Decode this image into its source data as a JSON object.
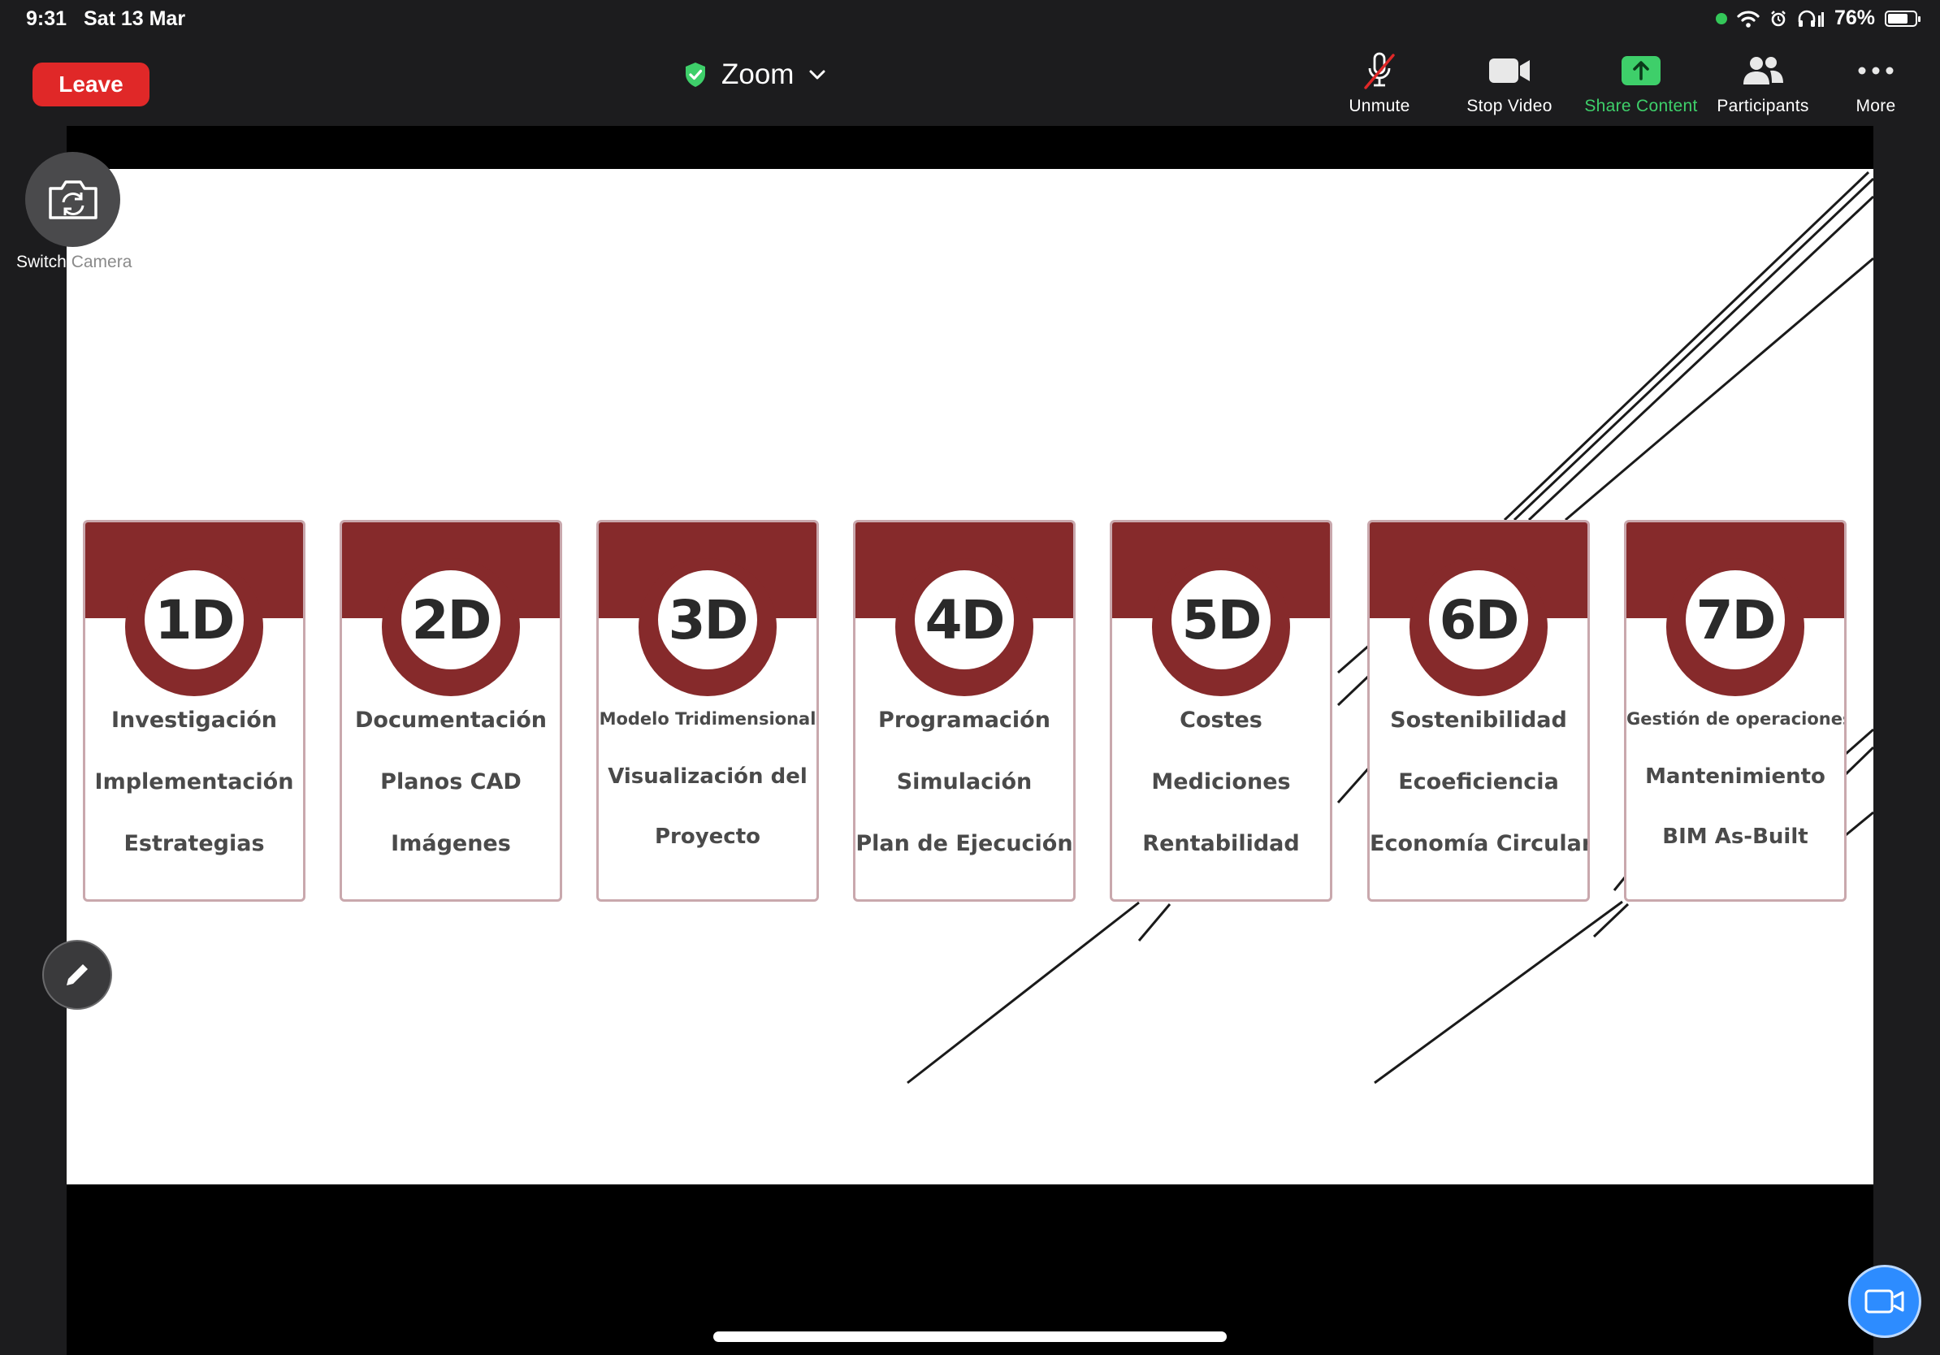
{
  "status_bar": {
    "time": "9:31",
    "date": "Sat 13 Mar",
    "battery_text": "76%",
    "battery_level": 0.76,
    "icons": [
      "green-dot",
      "wifi-icon",
      "alarm-icon",
      "headphones-icon",
      "battery-icon"
    ]
  },
  "toolbar": {
    "leave_label": "Leave",
    "meeting_title": "Zoom",
    "unmute_label": "Unmute",
    "stop_video_label": "Stop Video",
    "share_content_label": "Share Content",
    "participants_label": "Participants",
    "more_label": "More"
  },
  "overlay": {
    "switch_camera_label": "Switch",
    "switch_camera_label_faded": "Camera"
  },
  "slide": {
    "cards": [
      {
        "title": "1D",
        "lines": [
          "Investigación",
          "Implementación",
          "Estrategias"
        ]
      },
      {
        "title": "2D",
        "lines": [
          "Documentación",
          "Planos CAD",
          "Imágenes"
        ]
      },
      {
        "title": "3D",
        "lines": [
          "Modelo Tridimensional",
          "Visualización del",
          "Proyecto"
        ]
      },
      {
        "title": "4D",
        "lines": [
          "Programación",
          "Simulación",
          "Plan de Ejecución"
        ]
      },
      {
        "title": "5D",
        "lines": [
          "Costes",
          "Mediciones",
          "Rentabilidad"
        ]
      },
      {
        "title": "6D",
        "lines": [
          "Sostenibilidad",
          "Ecoeficiencia",
          "Economía Circular"
        ]
      },
      {
        "title": "7D",
        "lines": [
          "Gestión de operaciones",
          "Mantenimiento",
          "BIM As-Built"
        ]
      }
    ]
  },
  "colors": {
    "leave": "#e02828",
    "share_green": "#3ecf6a",
    "card_maroon": "#862a2b",
    "video_fab": "#2d8cff",
    "shield_green": "#3ecf6a"
  }
}
